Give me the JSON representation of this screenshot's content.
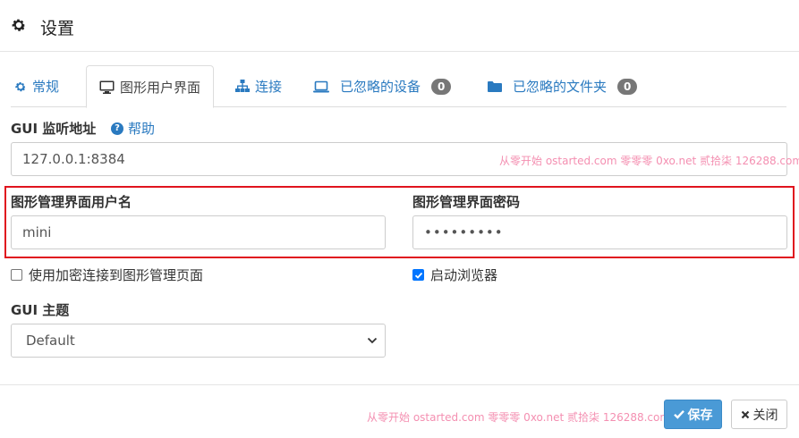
{
  "header": {
    "title": "设置",
    "icon": "gear-icon"
  },
  "tabs": [
    {
      "label": "常规",
      "icon": "gear-icon",
      "active": false
    },
    {
      "label": "图形用户界面",
      "icon": "monitor-icon",
      "active": true
    },
    {
      "label": "连接",
      "icon": "sitemap-icon",
      "active": false
    },
    {
      "label": "已忽略的设备",
      "icon": "laptop-icon",
      "badge": "0",
      "active": false
    },
    {
      "label": "已忽略的文件夹",
      "icon": "folder-icon",
      "badge": "0",
      "active": false
    }
  ],
  "gui_listen": {
    "label": "GUI 监听地址",
    "help_label": "帮助",
    "value": "127.0.0.1:8384"
  },
  "watermark": "从零开始 ostarted.com 零零零 0xo.net 贰拾柒 126288.com",
  "username": {
    "label": "图形管理界面用户名",
    "value": "mini"
  },
  "password": {
    "label": "图形管理界面密码",
    "value": "•••••••••"
  },
  "checkboxes": {
    "https": {
      "label": "使用加密连接到图形管理页面",
      "checked": false
    },
    "browser": {
      "label": "启动浏览器",
      "checked": true
    }
  },
  "theme": {
    "label": "GUI 主题",
    "value": "Default"
  },
  "footer": {
    "save_label": "保存",
    "close_label": "关闭"
  },
  "colors": {
    "link": "#2a7ac0",
    "highlight": "#e0141e",
    "primary_button": "#4a9ad6",
    "watermark": "#f48fb1"
  }
}
